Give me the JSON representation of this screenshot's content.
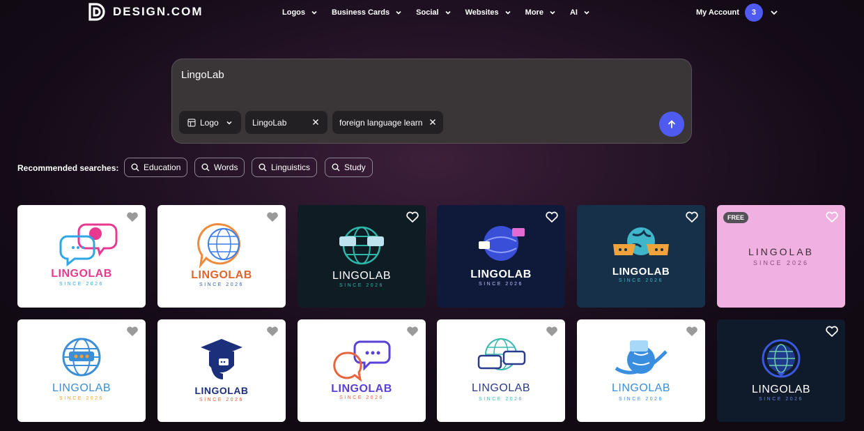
{
  "header": {
    "brand": "DESIGN.COM",
    "nav": [
      {
        "label": "Logos"
      },
      {
        "label": "Business Cards"
      },
      {
        "label": "Social"
      },
      {
        "label": "Websites"
      },
      {
        "label": "More"
      },
      {
        "label": "AI"
      }
    ],
    "account_label": "My Account",
    "account_badge": "3"
  },
  "search": {
    "query": "LingoLab",
    "type_chip": "Logo",
    "name_chip": "LingoLab",
    "topic_chip": "foreign language learn"
  },
  "recommended": {
    "label": "Recommended searches:",
    "items": [
      "Education",
      "Words",
      "Linguistics",
      "Study"
    ]
  },
  "cards": [
    {
      "title": "LINGOLAB",
      "sub": "SINCE 2026",
      "bg": "#ffffff",
      "heart": "gray"
    },
    {
      "title": "LINGOLAB",
      "sub": "SINCE 2026",
      "bg": "#ffffff",
      "heart": "gray"
    },
    {
      "title": "LINGOLAB",
      "sub": "SINCE 2026",
      "bg": "#0f1c24",
      "heart": "white"
    },
    {
      "title": "LINGOLAB",
      "sub": "SINCE 2026",
      "bg": "#0f1a3a",
      "heart": "white"
    },
    {
      "title": "LINGOLAB",
      "sub": "SINCE 2026",
      "bg": "#16304a",
      "heart": "white"
    },
    {
      "title": "LINGOLAB",
      "sub": "SINCE 2026",
      "bg": "#f1b1e0",
      "heart": "white",
      "badge": "FREE"
    },
    {
      "title": "LINGOLAB",
      "sub": "SINCE 2026",
      "bg": "#ffffff",
      "heart": "gray"
    },
    {
      "title": "LINGOLAB",
      "sub": "SINCE 2026",
      "bg": "#ffffff",
      "heart": "gray"
    },
    {
      "title": "LINGOLAB",
      "sub": "SINCE 2026",
      "bg": "#ffffff",
      "heart": "gray"
    },
    {
      "title": "LINGOLAB",
      "sub": "SINCE 2026",
      "bg": "#ffffff",
      "heart": "gray"
    },
    {
      "title": "LINGOLAB",
      "sub": "SINCE 2026",
      "bg": "#ffffff",
      "heart": "gray"
    },
    {
      "title": "LINGOLAB",
      "sub": "SINCE 2026",
      "bg": "#0f1a2a",
      "heart": "white"
    }
  ],
  "colors": {
    "accent": "#4f5bf0"
  }
}
